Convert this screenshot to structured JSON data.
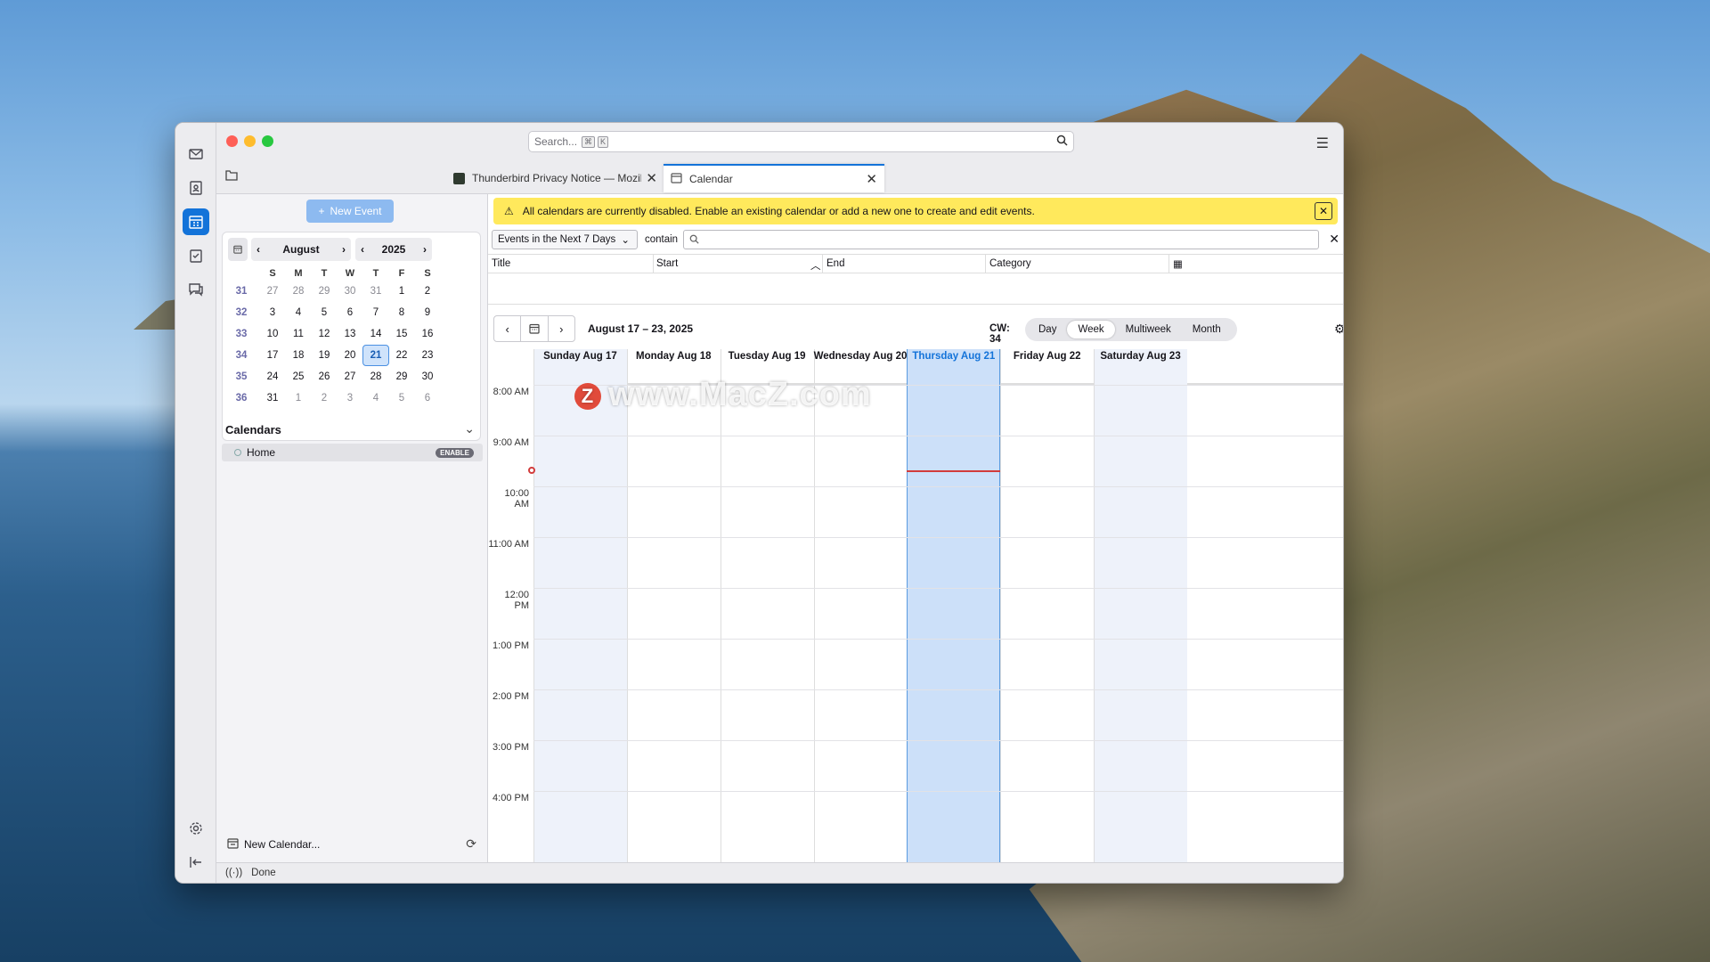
{
  "search": {
    "placeholder": "Search...",
    "kbd1": "⌘",
    "kbd2": "K"
  },
  "tabs": [
    {
      "label": "Thunderbird Privacy Notice — Mozil"
    },
    {
      "label": "Calendar"
    }
  ],
  "new_event": "New Event",
  "mini_calendar": {
    "month": "August",
    "year": "2025",
    "weekdays": [
      "S",
      "M",
      "T",
      "W",
      "T",
      "F",
      "S"
    ],
    "weeks": [
      {
        "wk": "31",
        "days": [
          "27",
          "28",
          "29",
          "30",
          "31",
          "1",
          "2"
        ]
      },
      {
        "wk": "32",
        "days": [
          "3",
          "4",
          "5",
          "6",
          "7",
          "8",
          "9"
        ]
      },
      {
        "wk": "33",
        "days": [
          "10",
          "11",
          "12",
          "13",
          "14",
          "15",
          "16"
        ]
      },
      {
        "wk": "34",
        "days": [
          "17",
          "18",
          "19",
          "20",
          "21",
          "22",
          "23"
        ]
      },
      {
        "wk": "35",
        "days": [
          "24",
          "25",
          "26",
          "27",
          "28",
          "29",
          "30"
        ]
      },
      {
        "wk": "36",
        "days": [
          "31",
          "1",
          "2",
          "3",
          "4",
          "5",
          "6"
        ]
      }
    ],
    "today": "21"
  },
  "calendars": {
    "title": "Calendars",
    "items": [
      {
        "name": "Home",
        "badge": "ENABLE"
      }
    ],
    "new_calendar": "New Calendar..."
  },
  "status": "Done",
  "notice": "All calendars are currently disabled. Enable an existing calendar or add a new one to create and edit events.",
  "filter": {
    "select": "Events in the Next 7 Days",
    "contain": "contain"
  },
  "columns": [
    "Title",
    "Start",
    "End",
    "Category"
  ],
  "toolbar": {
    "range": "August 17 – 23, 2025",
    "cw": "CW: 34",
    "views": [
      "Day",
      "Week",
      "Multiweek",
      "Month"
    ],
    "active_view": "Week"
  },
  "days": [
    "Sunday Aug 17",
    "Monday Aug 18",
    "Tuesday Aug 19",
    "Wednesday Aug 20",
    "Thursday Aug 21",
    "Friday Aug 22",
    "Saturday Aug 23"
  ],
  "hours": [
    "8:00 AM",
    "9:00 AM",
    "10:00 AM",
    "11:00 AM",
    "12:00 PM",
    "1:00 PM",
    "2:00 PM",
    "3:00 PM",
    "4:00 PM"
  ],
  "watermark": {
    "logo": "Z",
    "text": "www.MacZ.com"
  },
  "colors": {
    "accent": "#1373d9",
    "today_column": "#cce0f9",
    "weekend": "#eef2fa",
    "notice": "#ffe95c",
    "now_line": "#d23b3b"
  }
}
